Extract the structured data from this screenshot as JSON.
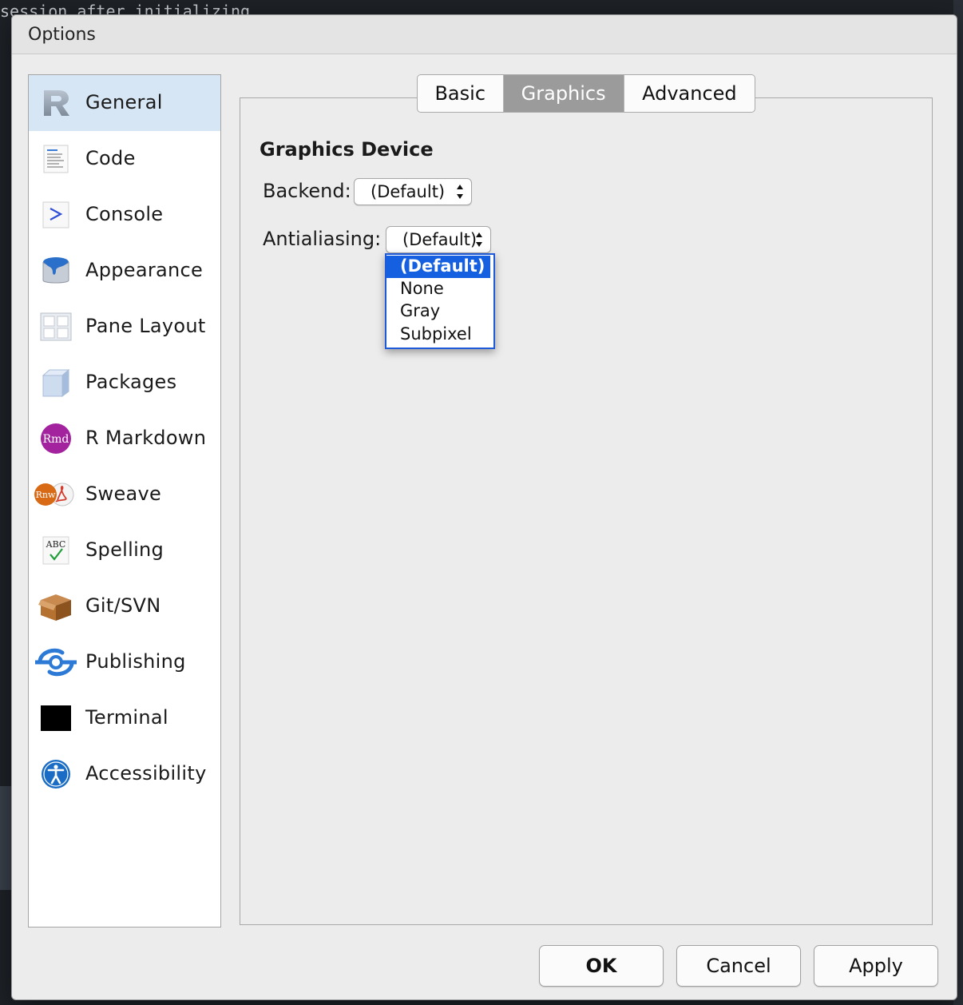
{
  "background": {
    "code_fragment": "session after initializing"
  },
  "dialog": {
    "title": "Options"
  },
  "sidebar": {
    "items": [
      {
        "label": "General",
        "icon": "r-logo-icon",
        "selected": true
      },
      {
        "label": "Code",
        "icon": "code-document-icon"
      },
      {
        "label": "Console",
        "icon": "console-prompt-icon"
      },
      {
        "label": "Appearance",
        "icon": "paint-bucket-icon"
      },
      {
        "label": "Pane Layout",
        "icon": "pane-grid-icon"
      },
      {
        "label": "Packages",
        "icon": "package-cube-icon"
      },
      {
        "label": "R Markdown",
        "icon": "rmd-icon"
      },
      {
        "label": "Sweave",
        "icon": "sweave-icon"
      },
      {
        "label": "Spelling",
        "icon": "spellcheck-icon"
      },
      {
        "label": "Git/SVN",
        "icon": "git-box-icon"
      },
      {
        "label": "Publishing",
        "icon": "publishing-icon"
      },
      {
        "label": "Terminal",
        "icon": "terminal-icon"
      },
      {
        "label": "Accessibility",
        "icon": "accessibility-icon"
      }
    ]
  },
  "tabs": [
    {
      "label": "Basic"
    },
    {
      "label": "Graphics",
      "active": true
    },
    {
      "label": "Advanced"
    }
  ],
  "graphics": {
    "section_title": "Graphics Device",
    "backend_label": "Backend:",
    "backend_value": "(Default)",
    "antialiasing_label": "Antialiasing:",
    "antialiasing_value": "(Default)",
    "antialiasing_options": [
      "(Default)",
      "None",
      "Gray",
      "Subpixel"
    ],
    "highlighted_option": "(Default)"
  },
  "buttons": {
    "ok": "OK",
    "cancel": "Cancel",
    "apply": "Apply"
  },
  "colors": {
    "selection_blue": "#1460e0",
    "sidebar_selected": "#d6e6f5",
    "active_tab": "#9b9b9b"
  }
}
